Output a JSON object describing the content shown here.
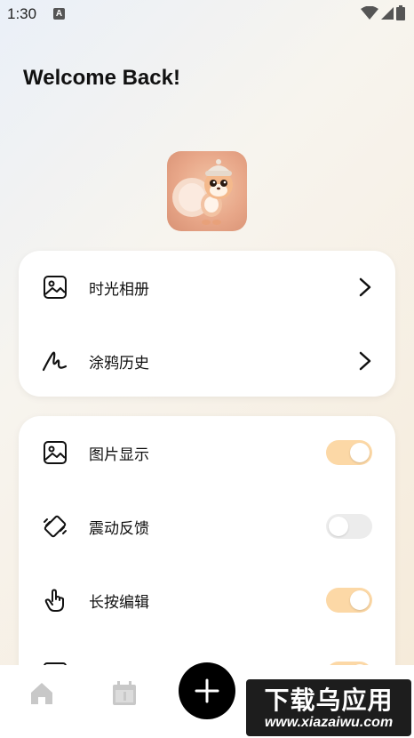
{
  "status_bar": {
    "time": "1:30",
    "notification_letter": "A"
  },
  "header": {
    "title": "Welcome Back!"
  },
  "menu_card": {
    "items": [
      {
        "label": "时光相册",
        "icon": "image-icon"
      },
      {
        "label": "涂鸦历史",
        "icon": "scribble-icon"
      }
    ]
  },
  "settings_card": {
    "items": [
      {
        "label": "图片显示",
        "icon": "image-icon",
        "toggle_on": true
      },
      {
        "label": "震动反馈",
        "icon": "vibration-icon",
        "toggle_on": false
      },
      {
        "label": "长按编辑",
        "icon": "touch-icon",
        "toggle_on": true
      }
    ]
  },
  "bottom_nav": {
    "items": [
      "home-icon",
      "calendar-icon",
      "add-icon"
    ]
  },
  "watermark": {
    "top": "下载乌应用",
    "bottom": "www.xiazaiwu.com"
  },
  "colors": {
    "toggle_on": "#fcd8a6",
    "toggle_off": "#ececec",
    "fab": "#000000"
  }
}
